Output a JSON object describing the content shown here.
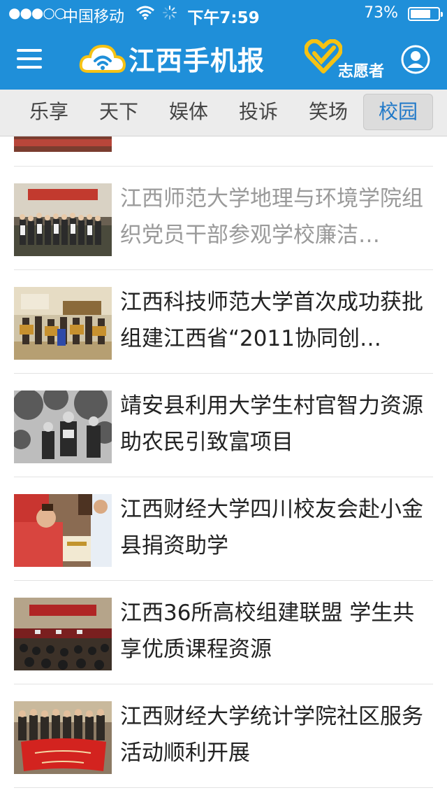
{
  "status_bar": {
    "signal": "●●●○○",
    "carrier": "中国移动",
    "time": "下午7:59",
    "battery": "73%",
    "battery_level": 0.73
  },
  "nav": {
    "app_name": "江西手机报",
    "volunteer_label": "志愿者",
    "brand_color": "#1f8fd9",
    "accent_color": "#f5c214"
  },
  "tabs": [
    {
      "label": "乐享",
      "active": false
    },
    {
      "label": "天下",
      "active": false
    },
    {
      "label": "娱体",
      "active": false
    },
    {
      "label": "投诉",
      "active": false
    },
    {
      "label": "笑场",
      "active": false
    },
    {
      "label": "校园",
      "active": true
    }
  ],
  "articles": [
    {
      "title": "江西师范大学地理与环境学院组织党员干部参观学校廉洁…",
      "read": true,
      "thumb_icon": "group-photo"
    },
    {
      "title": "江西科技师范大学首次成功获批组建江西省“2011协同创…",
      "read": false,
      "thumb_icon": "award-ceremony-photo"
    },
    {
      "title": "靖安县利用大学生村官智力资源助农民引致富项目",
      "read": false,
      "thumb_icon": "orchard-photo"
    },
    {
      "title": "江西财经大学四川校友会赴小金县捐资助学",
      "read": false,
      "thumb_icon": "donation-photo"
    },
    {
      "title": "江西36所高校组建联盟 学生共享优质课程资源",
      "read": false,
      "thumb_icon": "conference-photo"
    },
    {
      "title": "江西财经大学统计学院社区服务活动顺利开展",
      "read": false,
      "thumb_icon": "volunteer-group-photo"
    }
  ]
}
